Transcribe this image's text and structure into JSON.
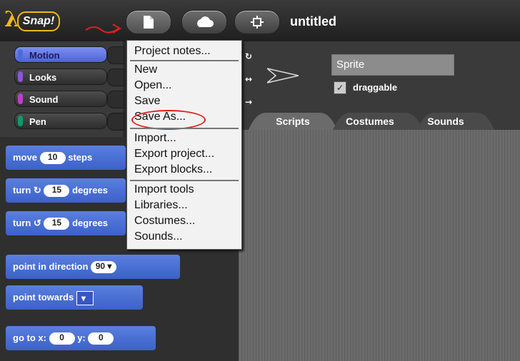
{
  "topbar": {
    "logo_text": "Snap!",
    "project_title": "untitled",
    "accent_color": "#f6b718",
    "annotation_color": "#e02020"
  },
  "categories": [
    {
      "label": "Motion",
      "color": "#4a6cd4",
      "selected": true
    },
    {
      "label": "Looks",
      "color": "#8a55d7"
    },
    {
      "label": "Sound",
      "color": "#bb42c3"
    },
    {
      "label": "Pen",
      "color": "#0e9a6c"
    }
  ],
  "palette": {
    "move": {
      "text": "move",
      "value": "10",
      "suffix": "steps"
    },
    "turn_cw": {
      "text": "turn",
      "value": "15",
      "suffix": "degrees"
    },
    "turn_ccw": {
      "text": "turn",
      "value": "15",
      "suffix": "degrees"
    },
    "point_dir": {
      "text": "point in direction",
      "value": "90"
    },
    "point_towards": {
      "text": "point towards"
    },
    "goto": {
      "text": "go to x:",
      "x": "0",
      "ylabel": "y:",
      "y": "0"
    }
  },
  "sprite": {
    "name": "Sprite",
    "draggable_label": "draggable",
    "tabs": [
      "Scripts",
      "Costumes",
      "Sounds"
    ]
  },
  "menu": {
    "items": [
      "Project notes...",
      "New",
      "Open...",
      "Save",
      "Save As...",
      "Import...",
      "Export project...",
      "Export blocks...",
      "Import tools",
      "Libraries...",
      "Costumes...",
      "Sounds..."
    ]
  }
}
